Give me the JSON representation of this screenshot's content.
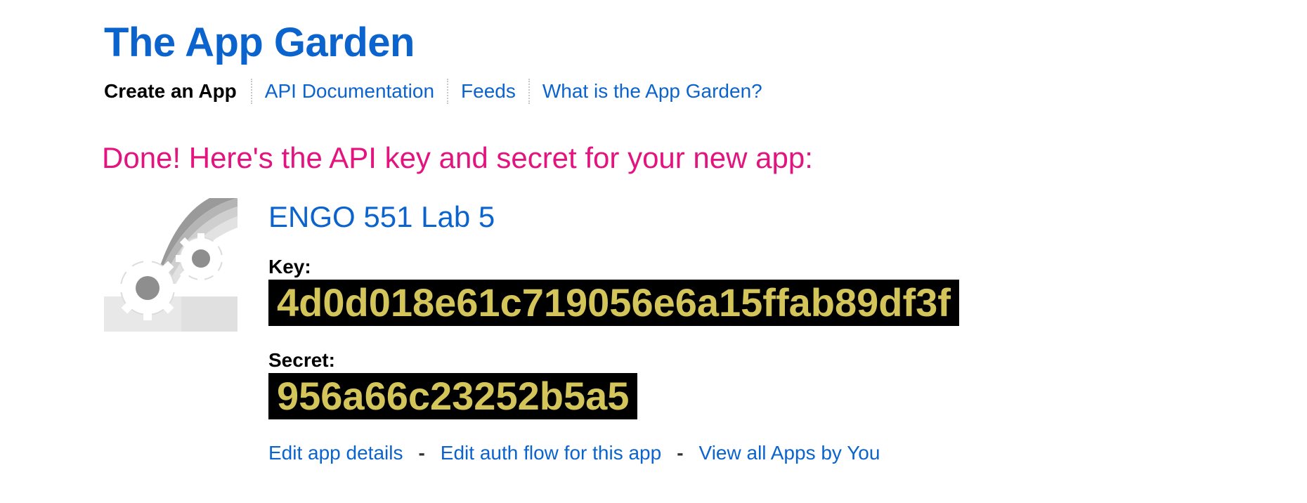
{
  "header": {
    "title": "The App Garden"
  },
  "nav": {
    "items": [
      {
        "label": "Create an App"
      },
      {
        "label": "API Documentation"
      },
      {
        "label": "Feeds"
      },
      {
        "label": "What is the App Garden?"
      }
    ]
  },
  "main": {
    "done_heading": "Done! Here's the API key and secret for your new app:",
    "app_name": "ENGO 551 Lab 5",
    "key_label": "Key:",
    "key_value": "4d0d018e61c719056e6a15ffab89df3f",
    "secret_label": "Secret:",
    "secret_value": "956a66c23252b5a5",
    "icon": "app-gears-icon",
    "links": {
      "edit_details": "Edit app details",
      "edit_auth": "Edit auth flow for this app",
      "view_all": "View all Apps by You",
      "separator": "-"
    }
  },
  "colors": {
    "brand_blue": "#0b63ce",
    "heading_pink": "#e3137f",
    "code_text": "#d4c55a",
    "code_bg": "#000000"
  }
}
